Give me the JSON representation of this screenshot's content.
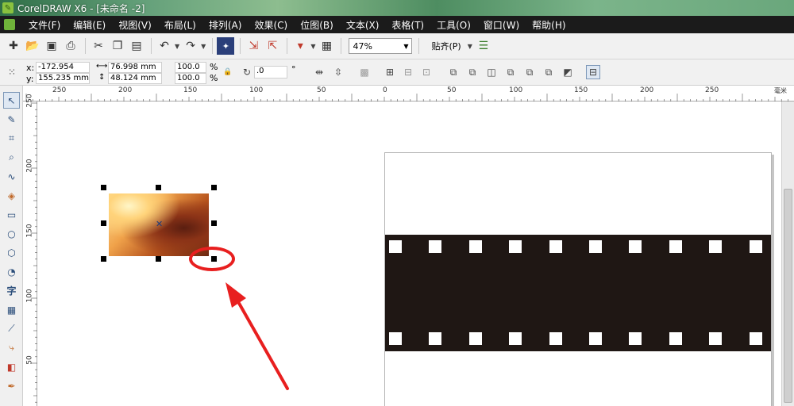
{
  "window": {
    "title": "CorelDRAW X6 - [未命名 -2]"
  },
  "menu": {
    "items": [
      "文件(F)",
      "编辑(E)",
      "视图(V)",
      "布局(L)",
      "排列(A)",
      "效果(C)",
      "位图(B)",
      "文本(X)",
      "表格(T)",
      "工具(O)",
      "窗口(W)",
      "帮助(H)"
    ]
  },
  "toolbar": {
    "zoom_value": "47%",
    "snap_label": "贴齐(P)"
  },
  "property_bar": {
    "x_label": "x:",
    "x_value": "-172.954 mm",
    "y_label": "y:",
    "y_value": "155.235 mm",
    "width_value": "76.998 mm",
    "height_value": "48.124 mm",
    "scale_w": "100.0",
    "scale_h": "100.0",
    "percent_symbol": "%",
    "rotation_value": ".0",
    "degree_symbol": "°"
  },
  "ruler": {
    "unit": "毫米",
    "h_labels": [
      "250",
      "200",
      "150",
      "100",
      "50",
      "0",
      "50",
      "100",
      "150",
      "200",
      "250"
    ],
    "v_labels": [
      "250",
      "200",
      "150",
      "100",
      "50"
    ]
  },
  "colors": {
    "menu_bg": "#1b1b1b",
    "film_strip": "#1f1714",
    "annotation": "#e81f1f"
  },
  "icons": {
    "toolbox": [
      "pick-tool-icon",
      "shape-tool-icon",
      "crop-tool-icon",
      "zoom-tool-icon",
      "freehand-tool-icon",
      "smart-fill-icon",
      "rectangle-tool-icon",
      "ellipse-tool-icon",
      "polygon-tool-icon",
      "basic-shapes-icon",
      "text-tool-icon",
      "table-tool-icon",
      "dimension-tool-icon",
      "connector-tool-icon",
      "blend-tool-icon",
      "eyedropper-tool-icon"
    ]
  }
}
